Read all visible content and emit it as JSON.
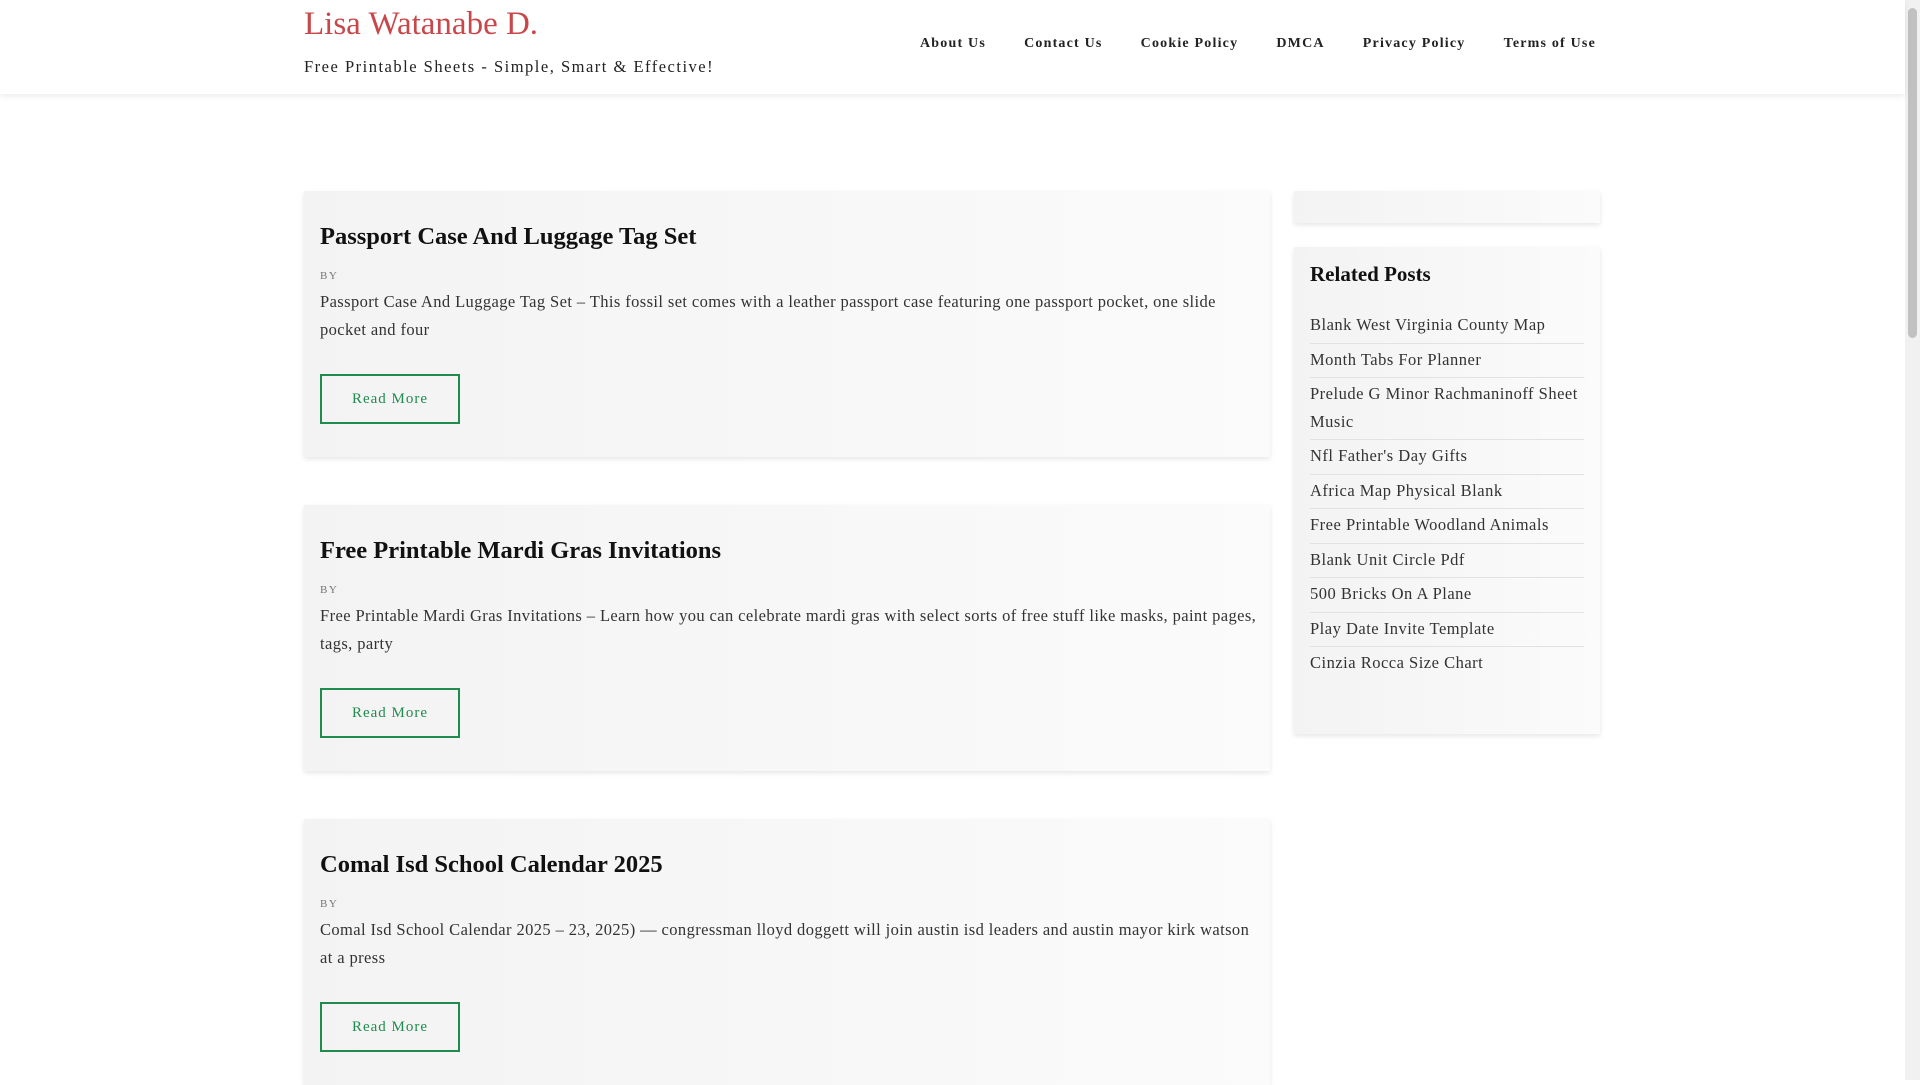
{
  "header": {
    "site_title": "Lisa Watanabe D.",
    "tagline": "Free Printable Sheets - Simple, Smart & Effective!",
    "nav": [
      "About Us",
      "Contact Us",
      "Cookie Policy",
      "DMCA",
      "Privacy Policy",
      "Terms of Use"
    ]
  },
  "posts": [
    {
      "title": "Passport Case And Luggage Tag Set",
      "by": "BY",
      "excerpt": "Passport Case And Luggage Tag Set – This fossil set comes with a leather passport case featuring one passport pocket, one slide pocket and four",
      "read_more": "Read More"
    },
    {
      "title": "Free Printable Mardi Gras Invitations",
      "by": "BY",
      "excerpt": "Free Printable Mardi Gras Invitations – Learn how you can celebrate mardi gras with select sorts of free stuff like masks, paint pages, tags, party",
      "read_more": "Read More"
    },
    {
      "title": "Comal Isd School Calendar 2025",
      "by": "BY",
      "excerpt": "Comal Isd School Calendar 2025 – 23, 2025) — congressman lloyd doggett will join austin isd leaders and austin mayor kirk watson at a press",
      "read_more": "Read More"
    }
  ],
  "sidebar": {
    "related_title": "Related Posts",
    "related_posts": [
      "Blank West Virginia County Map",
      "Month Tabs For Planner",
      "Prelude G Minor Rachmaninoff Sheet Music",
      "Nfl Father's Day Gifts",
      "Africa Map Physical Blank",
      "Free Printable Woodland Animals",
      "Blank Unit Circle Pdf",
      "500 Bricks On A Plane",
      "Play Date Invite Template",
      "Cinzia Rocca Size Chart"
    ]
  },
  "colors": {
    "site_title": "#c8474a",
    "button_accent": "#1f8c4e"
  }
}
